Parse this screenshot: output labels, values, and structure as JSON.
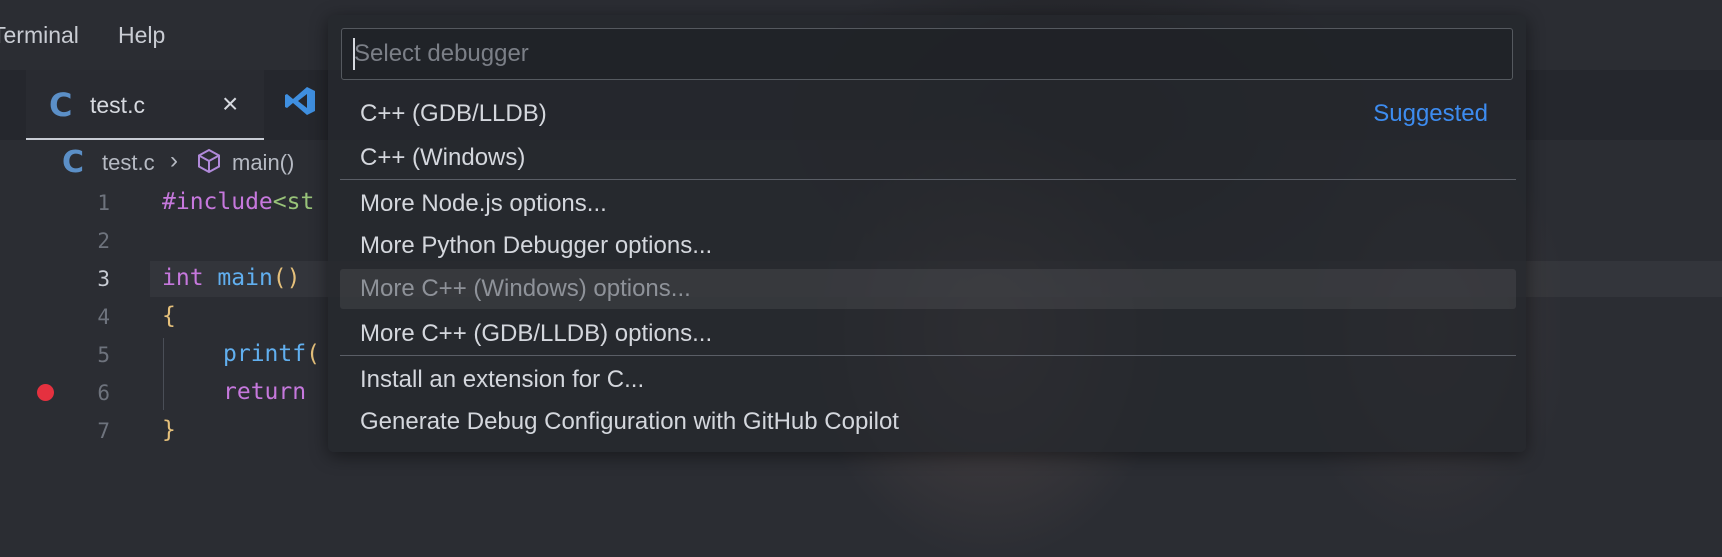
{
  "menu": {
    "terminal": "Terminal",
    "help": "Help"
  },
  "tab": {
    "icon_letter": "C",
    "label": "test.c",
    "close": "×"
  },
  "breadcrumb": {
    "file_icon_letter": "C",
    "file": "test.c",
    "separator": "›",
    "symbol": "main()"
  },
  "editor": {
    "line_numbers": [
      "1",
      "2",
      "3",
      "4",
      "5",
      "6",
      "7"
    ],
    "current_line": "3",
    "breakpoint_line": "6",
    "lines": {
      "l1_directive": "#include",
      "l1_rest": "<st",
      "l3_type": "int",
      "l3_name": "main",
      "l3_parens": "()",
      "l4": "{",
      "l5_fn": "printf",
      "l5_paren": "(",
      "l6": "return",
      "l7": "}"
    }
  },
  "quickpick": {
    "placeholder": "Select debugger",
    "suggested_badge": "Suggested",
    "items": [
      "C++ (GDB/LLDB)",
      "C++ (Windows)",
      "More Node.js options...",
      "More Python Debugger options...",
      "More C++ (Windows) options...",
      "More C++ (GDB/LLDB) options...",
      "Install an extension for C...",
      "Generate Debug Configuration with GitHub Copilot"
    ],
    "active_index": 4
  },
  "colors": {
    "keyword": "#c678dd",
    "function": "#61afef",
    "string": "#98c379",
    "bracket": "#e5c07b",
    "link": "#3d8cf0",
    "breakpoint": "#e5313f"
  }
}
